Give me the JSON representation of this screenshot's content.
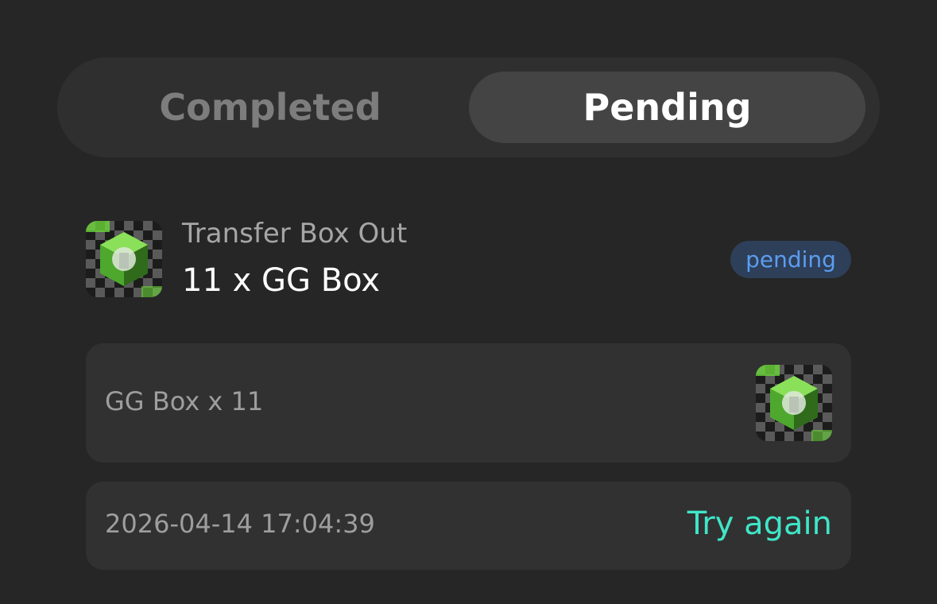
{
  "tabs": {
    "completed_label": "Completed",
    "pending_label": "Pending",
    "active": "Pending"
  },
  "transaction": {
    "type": "Transfer Box Out",
    "quantity_text": "11 x GG Box",
    "status": "pending",
    "thumbnail_icon": "gg-box-icon"
  },
  "item_card": {
    "label": "GG Box x 11",
    "thumbnail_icon": "gg-box-icon"
  },
  "time_card": {
    "timestamp": "2026-04-14 17:04:39",
    "retry_label": "Try again"
  },
  "colors": {
    "background": "#262626",
    "accent_retry": "#3fe6c8",
    "badge_text": "#5b9df0",
    "badge_bg": "#2e3f59",
    "box_green": "#6bd63a"
  }
}
